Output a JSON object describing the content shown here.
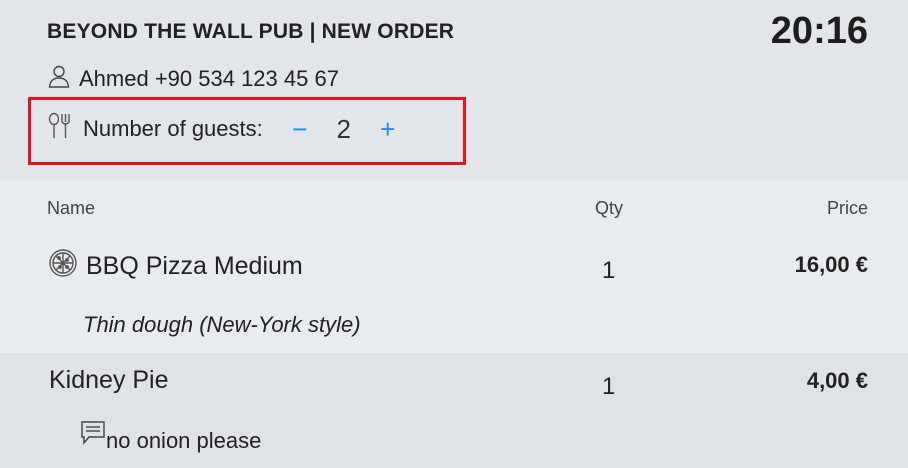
{
  "header": {
    "venue": "BEYOND THE WALL PUB",
    "separator": "|",
    "mode": "NEW ORDER",
    "clock": "20:16",
    "customer": "Ahmed +90 534 123 45 67",
    "customer_icon": "person-icon",
    "guests_icon": "cutlery-icon",
    "guests_label": "Number of guests:",
    "guests_minus": "−",
    "guests_count": "2",
    "guests_plus": "+",
    "highlight_color": "#e8141a",
    "accent_color": "#1a8fe0"
  },
  "table": {
    "columns": {
      "name": "Name",
      "qty": "Qty",
      "price": "Price"
    },
    "items": [
      {
        "icon": "pizza-icon",
        "name": "BBQ Pizza Medium",
        "qty": "1",
        "price": "16,00 €",
        "note": "Thin dough (New-York style)"
      },
      {
        "name": "Kidney Pie",
        "qty": "1",
        "price": "4,00 €",
        "comment_icon": "comment-icon",
        "comment": "no onion please"
      }
    ]
  }
}
